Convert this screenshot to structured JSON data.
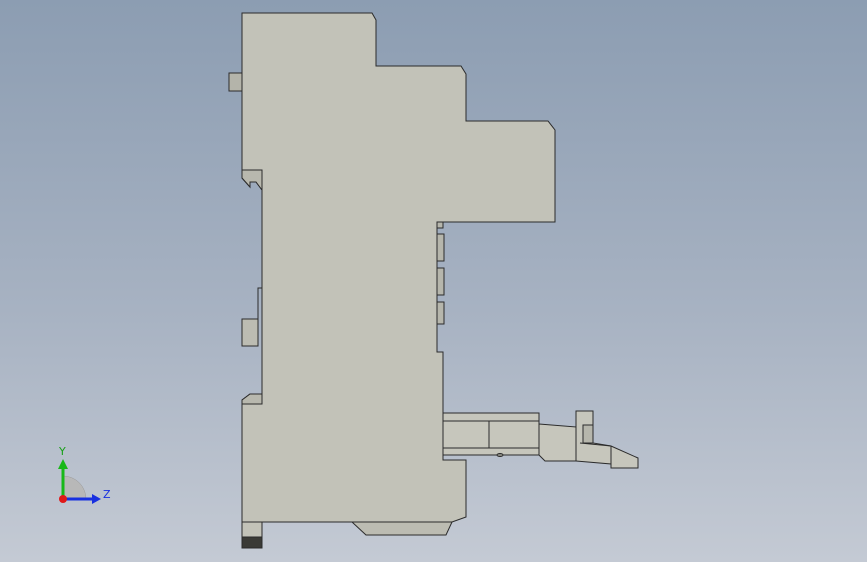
{
  "colors": {
    "part_fill": "#c2c2b8",
    "part_fill_dark": "#aeaea4",
    "part_stroke": "#2b2b2b",
    "terminal": "#3a3a36",
    "axis_x": "#e01818",
    "axis_y": "#18b818",
    "axis_z": "#1830e0"
  },
  "triad": {
    "y_label": "Y",
    "z_label": "Z"
  }
}
